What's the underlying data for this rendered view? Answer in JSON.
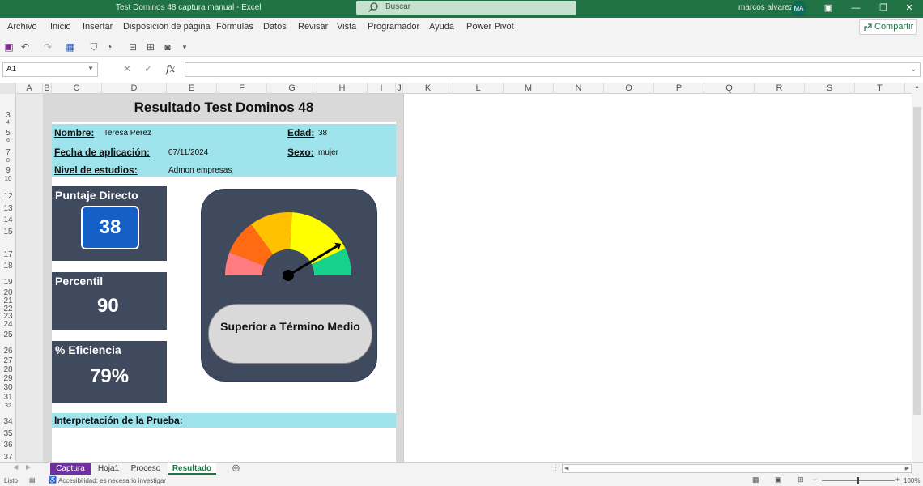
{
  "window": {
    "title": "Test Dominos 48 captura manual  -  Excel",
    "search_placeholder": "Buscar",
    "user_name": "marcos alvarez",
    "user_initials": "MA"
  },
  "menu": {
    "items": [
      "Archivo",
      "Inicio",
      "Insertar",
      "Disposición de página",
      "Fórmulas",
      "Datos",
      "Revisar",
      "Vista",
      "Programador",
      "Ayuda",
      "Power Pivot"
    ],
    "share_label": "Compartir"
  },
  "formula_bar": {
    "name_box": "A1",
    "fx_label": "fx",
    "formula": ""
  },
  "columns": [
    "A",
    "B",
    "C",
    "D",
    "E",
    "F",
    "G",
    "H",
    "I",
    "J",
    "K",
    "L",
    "M",
    "N",
    "O",
    "P",
    "Q",
    "R",
    "S",
    "T"
  ],
  "rows": [
    "3",
    "4",
    "5",
    "6",
    "7",
    "8",
    "9",
    "10",
    "12",
    "13",
    "14",
    "15",
    "17",
    "18",
    "19",
    "20",
    "21",
    "22",
    "23",
    "24",
    "25",
    "26",
    "27",
    "28",
    "29",
    "30",
    "31",
    "32",
    "34",
    "35",
    "36",
    "37"
  ],
  "sheet": {
    "title": "Resultado Test Dominos 48",
    "info": {
      "name_label": "Nombre:",
      "name_value": "Teresa Perez",
      "age_label": "Edad:",
      "age_value": "38",
      "date_label": "Fecha de aplicación:",
      "date_value": "07/11/2024",
      "sex_label": "Sexo:",
      "sex_value": "mujer",
      "edu_label": "Nivel de estudios:",
      "edu_value": "Admon empresas"
    },
    "stats": {
      "direct_label": "Puntaje Directo",
      "direct_value": "38",
      "percentile_label": "Percentil",
      "percentile_value": "90",
      "efficiency_label": "% Eficiencia",
      "efficiency_value": "79%"
    },
    "gauge": {
      "result_label": "Superior a Término Medio",
      "percentile": 90,
      "segment_colors": [
        "#ff7c80",
        "#ff6a13",
        "#ffc000",
        "#ffff00",
        "#18d28c"
      ]
    },
    "interpretation_label": "Interpretación de la Prueba:"
  },
  "tabs": [
    {
      "label": "Captura",
      "active": false,
      "color": "#7030a0"
    },
    {
      "label": "Hoja1",
      "active": false
    },
    {
      "label": "Proceso",
      "active": false
    },
    {
      "label": "Resultado",
      "active": true
    }
  ],
  "status": {
    "ready": "Listo",
    "accessibility": "Accesibilidad: es necesario investigar",
    "zoom": "100%"
  }
}
